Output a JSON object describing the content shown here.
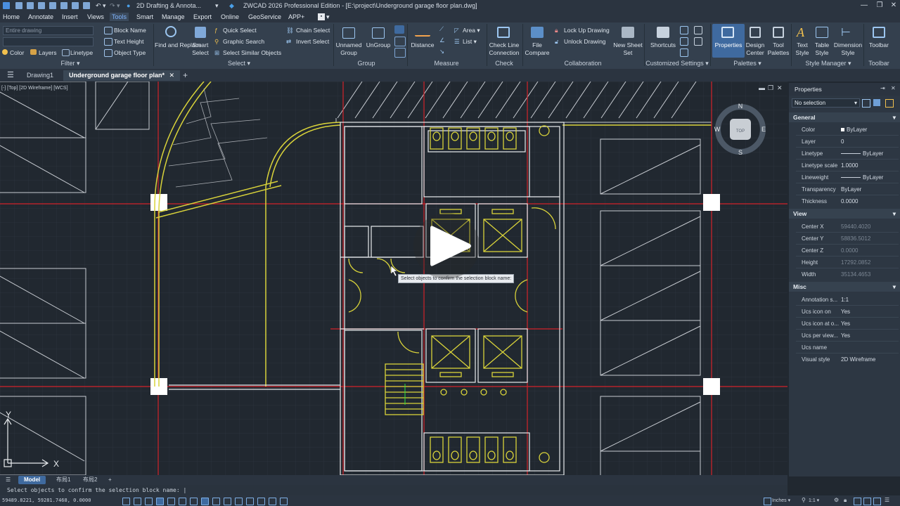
{
  "app": {
    "workspace": "2D Drafting & Annota...",
    "window_title": "ZWCAD 2026 Professional Edition - [E:\\project\\Underground garage floor plan.dwg]"
  },
  "menu": [
    "Home",
    "Annotate",
    "Insert",
    "Views",
    "Tools",
    "Smart",
    "Manage",
    "Export",
    "Online",
    "GeoService",
    "APP+"
  ],
  "ribbon": {
    "filter": {
      "dropdown": "Entire drawing",
      "items": [
        "Color",
        "Layers",
        "Linetype",
        "Block Name",
        "Text Height",
        "Object Type"
      ],
      "label": "Filter"
    },
    "select": {
      "find": "Find and Replace",
      "smart": "Smart Select",
      "items": [
        "Quick Select",
        "Graphic Search",
        "Select Similar Objects",
        "Chain Select",
        "Invert Select"
      ],
      "label": "Select"
    },
    "group": {
      "items": [
        "Unnamed Group",
        "UnGroup"
      ],
      "label": "Group"
    },
    "measure": {
      "items": [
        "Distance",
        "Area",
        "List"
      ],
      "label": "Measure"
    },
    "check": {
      "items": [
        "Check Line Connection"
      ],
      "label": "Check"
    },
    "collab": {
      "items": [
        "File Compare",
        "Lock Up Drawing",
        "Unlock Drawing",
        "New Sheet Set"
      ],
      "label": "Collaboration"
    },
    "custom": {
      "items": [
        "Shortcuts"
      ],
      "label": "Customized Settings"
    },
    "palettes": {
      "items": [
        "Properties",
        "Design Center",
        "Tool Palettes"
      ],
      "label": "Palettes"
    },
    "style": {
      "items": [
        "Text Style",
        "Table Style",
        "Dimension Style"
      ],
      "label": "Style Manager"
    },
    "toolbar": {
      "items": [
        "Toolbar"
      ],
      "label": "Toolbar"
    }
  },
  "tabs": [
    "Drawing1",
    "Underground garage floor plan*"
  ],
  "viewport": {
    "label": "[-] [Top] [2D Wireframe] [WCS]",
    "compass": {
      "n": "N",
      "s": "S",
      "e": "E",
      "w": "W",
      "top": "TOP"
    },
    "ucs_x": "X",
    "ucs_y": "Y"
  },
  "tooltip": "Select objects to confirm the selection block name:",
  "properties": {
    "title": "Properties",
    "selection": "No selection",
    "general": {
      "header": "General",
      "rows": [
        [
          "Color",
          "ByLayer"
        ],
        [
          "Layer",
          "0"
        ],
        [
          "Linetype",
          "ByLayer"
        ],
        [
          "Linetype scale",
          "1.0000"
        ],
        [
          "Lineweight",
          "ByLayer"
        ],
        [
          "Transparency",
          "ByLayer"
        ],
        [
          "Thickness",
          "0.0000"
        ]
      ]
    },
    "view": {
      "header": "View",
      "rows": [
        [
          "Center X",
          "59440.4020"
        ],
        [
          "Center Y",
          "58836.5012"
        ],
        [
          "Center Z",
          "0.0000"
        ],
        [
          "Height",
          "17292.0852"
        ],
        [
          "Width",
          "35134.4653"
        ]
      ]
    },
    "misc": {
      "header": "Misc",
      "rows": [
        [
          "Annotation s...",
          "1:1"
        ],
        [
          "Ucs icon on",
          "Yes"
        ],
        [
          "Ucs icon at o...",
          "Yes"
        ],
        [
          "Ucs per view...",
          "Yes"
        ],
        [
          "Ucs name",
          ""
        ],
        [
          "Visual style",
          "2D Wireframe"
        ]
      ]
    }
  },
  "layout_tabs": [
    "Model",
    "布局1",
    "布局2"
  ],
  "command_line": "Select objects to confirm the selection block name: |",
  "status": {
    "coords": "59489.8221, 59281.7468, 0.0000",
    "units": "Inches",
    "scale": "1:1"
  }
}
